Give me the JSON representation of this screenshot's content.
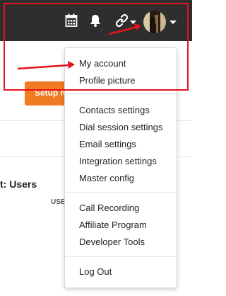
{
  "header": {
    "icons": [
      "calendar-icon",
      "bell-icon",
      "link-icon",
      "chevron-down-icon"
    ],
    "avatar": "avatar"
  },
  "page": {
    "setup_button_label": "Setup N",
    "section_title": "t: Users",
    "column_header": "USE"
  },
  "account_menu": {
    "groups": [
      [
        "My account",
        "Profile picture"
      ],
      [
        "Contacts settings",
        "Dial session settings",
        "Email settings",
        "Integration settings",
        "Master config"
      ],
      [
        "Call Recording",
        "Affiliate Program",
        "Developer Tools"
      ],
      [
        "Log Out"
      ]
    ]
  },
  "colors": {
    "topbar": "#2e2e2e",
    "setup_button": "#f07b22",
    "annotation": "#e5121b"
  }
}
